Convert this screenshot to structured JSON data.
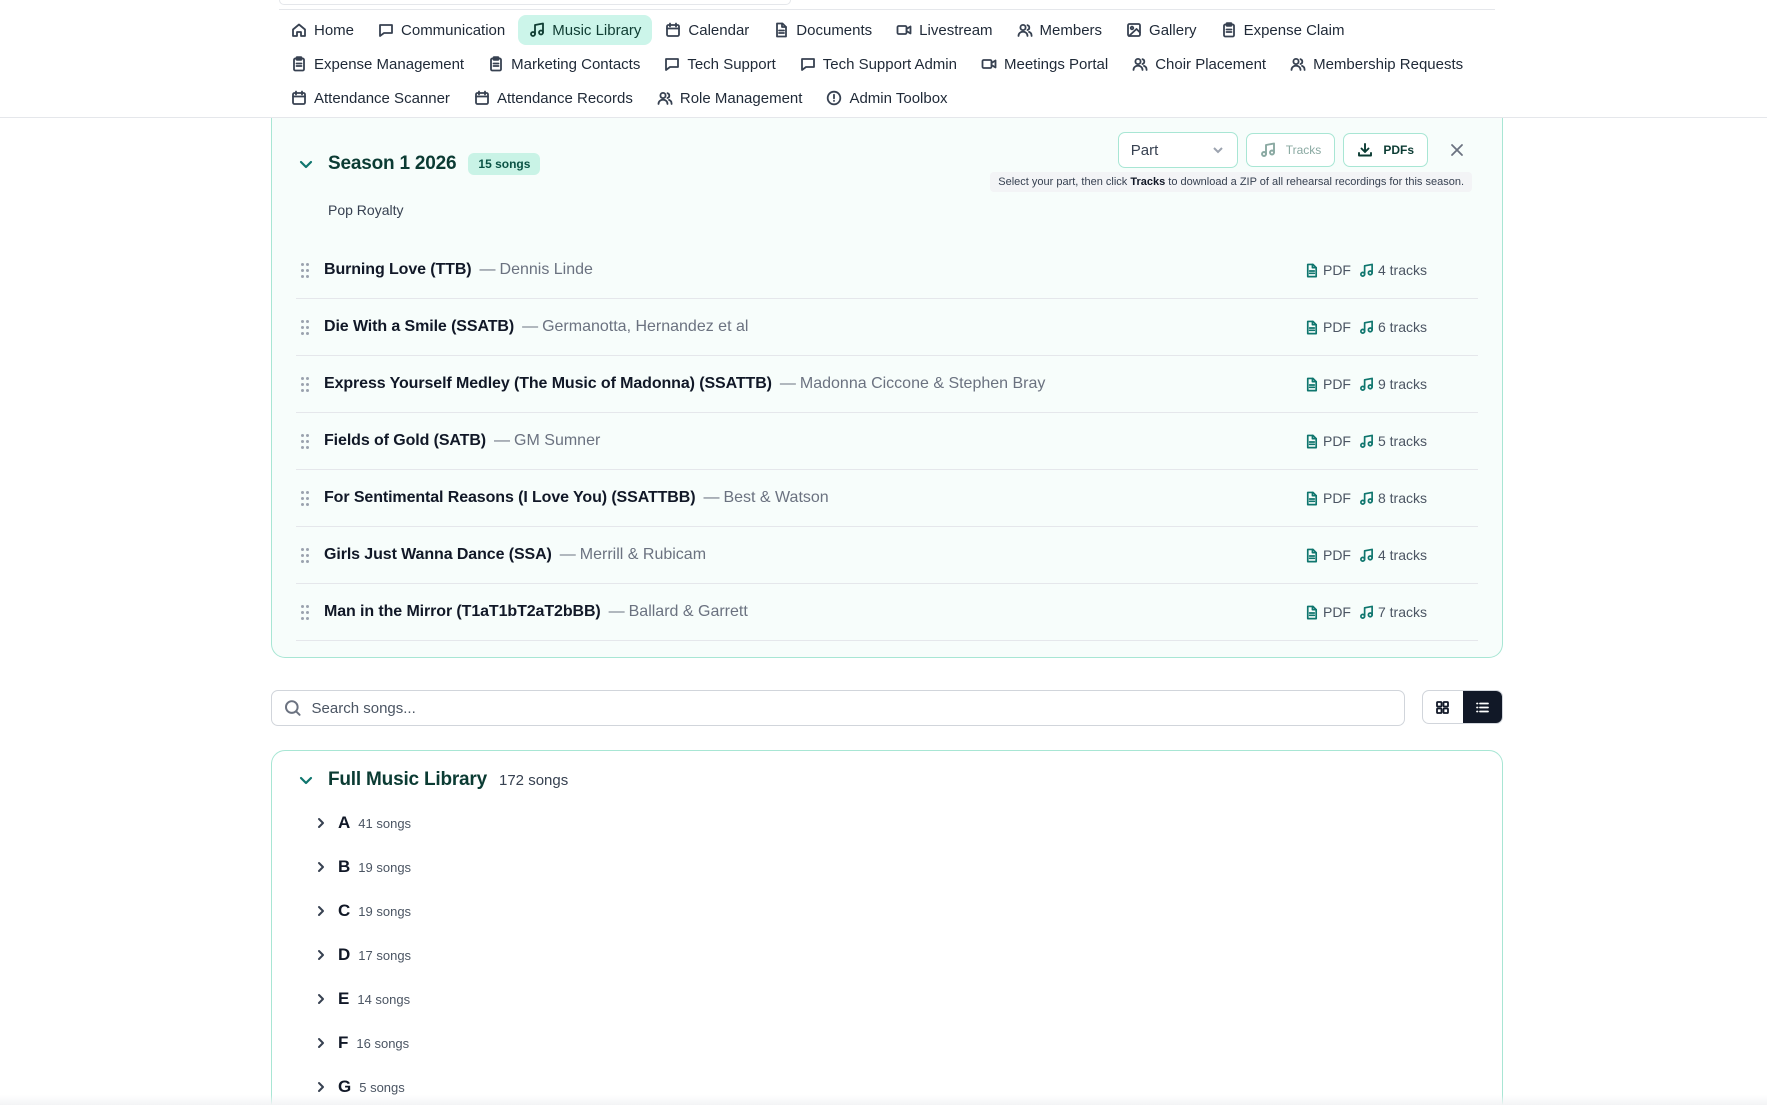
{
  "nav": {
    "rows": [
      [
        {
          "label": "Home",
          "icon": "home-icon",
          "active": false
        },
        {
          "label": "Communication",
          "icon": "chat-icon",
          "active": false
        },
        {
          "label": "Music Library",
          "icon": "music-icon",
          "active": true
        },
        {
          "label": "Calendar",
          "icon": "calendar-icon",
          "active": false
        },
        {
          "label": "Documents",
          "icon": "document-icon",
          "active": false
        },
        {
          "label": "Livestream",
          "icon": "video-icon",
          "active": false
        },
        {
          "label": "Members",
          "icon": "users-icon",
          "active": false
        },
        {
          "label": "Gallery",
          "icon": "image-icon",
          "active": false
        },
        {
          "label": "Expense Claim",
          "icon": "clipboard-icon",
          "active": false
        }
      ],
      [
        {
          "label": "Expense Management",
          "icon": "clipboard-icon",
          "active": false
        },
        {
          "label": "Marketing Contacts",
          "icon": "clipboard-icon",
          "active": false
        },
        {
          "label": "Tech Support",
          "icon": "chat-icon",
          "active": false
        },
        {
          "label": "Tech Support Admin",
          "icon": "chat-icon",
          "active": false
        },
        {
          "label": "Meetings Portal",
          "icon": "video-icon",
          "active": false
        },
        {
          "label": "Choir Placement",
          "icon": "users-icon",
          "active": false
        },
        {
          "label": "Membership Requests",
          "icon": "users-icon",
          "active": false
        }
      ],
      [
        {
          "label": "Attendance Scanner",
          "icon": "calendar-icon",
          "active": false
        },
        {
          "label": "Attendance Records",
          "icon": "calendar-icon",
          "active": false
        },
        {
          "label": "Role Management",
          "icon": "users-icon",
          "active": false
        },
        {
          "label": "Admin Toolbox",
          "icon": "alert-circle-icon",
          "active": false
        }
      ]
    ]
  },
  "season": {
    "title": "Season 1 2026",
    "badge": "15 songs",
    "subtitle": "Pop Royalty",
    "part_select": "Part",
    "tracks_label": "Tracks",
    "pdfs_label": "PDFs",
    "hint_prefix": "Select your part, then click ",
    "hint_bold": "Tracks",
    "hint_suffix": " to download a ZIP of all rehearsal recordings for this season.",
    "songs": [
      {
        "title": "Burning Love (TTB)",
        "artist": "Dennis Linde",
        "pdf": "PDF",
        "tracks": "4 tracks"
      },
      {
        "title": "Die With a Smile (SSATB)",
        "artist": "Germanotta, Hernandez et al",
        "pdf": "PDF",
        "tracks": "6 tracks"
      },
      {
        "title": "Express Yourself Medley (The Music of Madonna) (SSATTB)",
        "artist": "Madonna Ciccone & Stephen Bray",
        "pdf": "PDF",
        "tracks": "9 tracks"
      },
      {
        "title": "Fields of Gold (SATB)",
        "artist": "GM Sumner",
        "pdf": "PDF",
        "tracks": "5 tracks"
      },
      {
        "title": "For Sentimental Reasons (I Love You) (SSATTBB)",
        "artist": "Best & Watson",
        "pdf": "PDF",
        "tracks": "8 tracks"
      },
      {
        "title": "Girls Just Wanna Dance (SSA)",
        "artist": "Merrill & Rubicam",
        "pdf": "PDF",
        "tracks": "4 tracks"
      },
      {
        "title": "Man in the Mirror (T1aT1bT2aT2bBB)",
        "artist": "Ballard & Garrett",
        "pdf": "PDF",
        "tracks": "7 tracks"
      }
    ]
  },
  "search": {
    "placeholder": "Search songs...",
    "value": ""
  },
  "library": {
    "title": "Full Music Library",
    "count": "172 songs",
    "groups": [
      {
        "letter": "A",
        "count": "41 songs"
      },
      {
        "letter": "B",
        "count": "19 songs"
      },
      {
        "letter": "C",
        "count": "19 songs"
      },
      {
        "letter": "D",
        "count": "17 songs"
      },
      {
        "letter": "E",
        "count": "14 songs"
      },
      {
        "letter": "F",
        "count": "16 songs"
      },
      {
        "letter": "G",
        "count": "5 songs"
      }
    ]
  },
  "colors": {
    "accent": "#ccf5ea",
    "accent_border": "#a8e6d4",
    "accent_text": "#0f766e",
    "title_text": "#0b3b33"
  }
}
